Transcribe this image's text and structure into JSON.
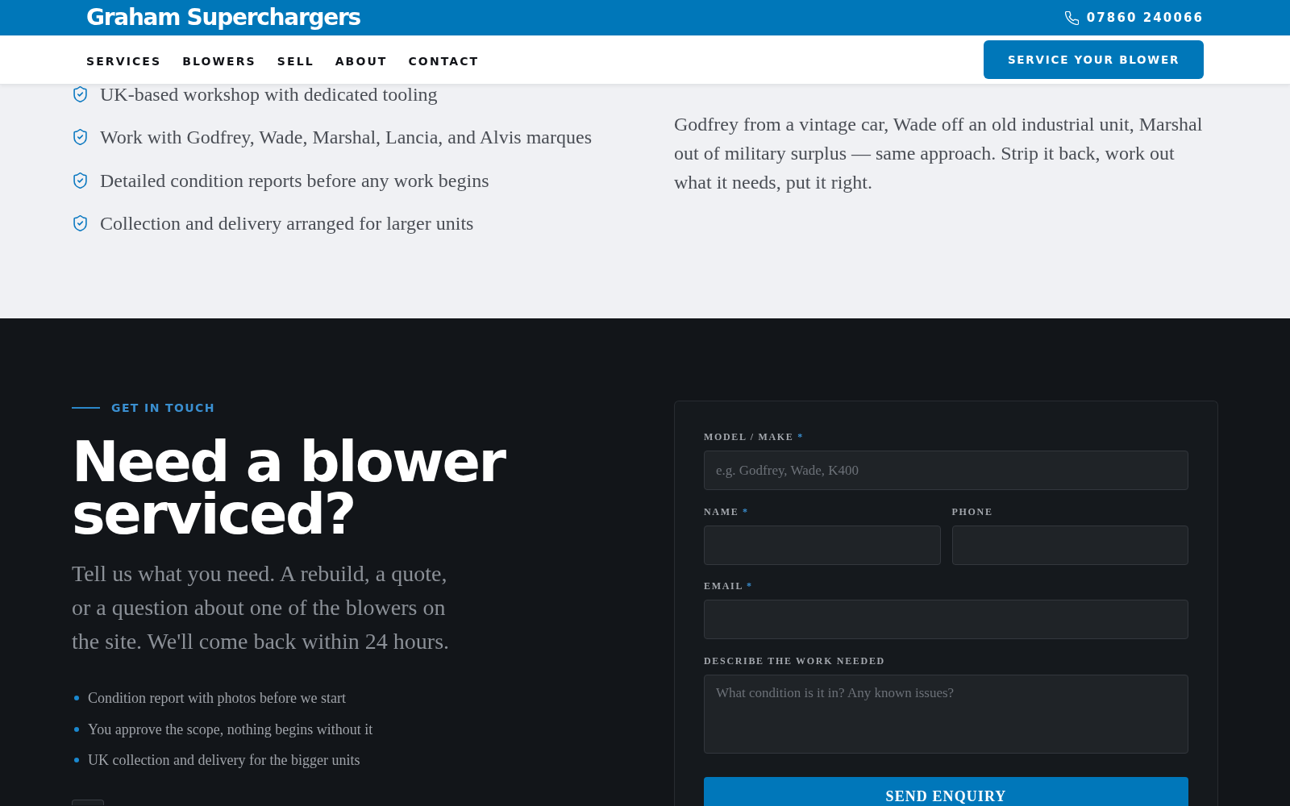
{
  "top_bar": {
    "logo": "Graham Superchargers",
    "phone": "07860 240066"
  },
  "nav": {
    "items": [
      {
        "label": "SERVICES"
      },
      {
        "label": "BLOWERS"
      },
      {
        "label": "SELL"
      },
      {
        "label": "ABOUT"
      },
      {
        "label": "CONTACT"
      }
    ],
    "cta": "SERVICE YOUR BLOWER"
  },
  "features": {
    "items": [
      "UK-based workshop with dedicated tooling",
      "Work with Godfrey, Wade, Marshal, Lancia, and Alvis marques",
      "Detailed condition reports before any work begins",
      "Collection and delivery arranged for larger units"
    ],
    "paragraph": "Godfrey from a vintage car, Wade off an old industrial unit, Marshal out of military surplus — same approach. Strip it back, work out what it needs, put it right."
  },
  "contact": {
    "eyebrow": "GET IN TOUCH",
    "heading": "Need a blower serviced?",
    "intro": "Tell us what you need. A rebuild, a quote, or a question about one of the blowers on the site. We'll come back within 24 hours.",
    "points": [
      "Condition report with photos before we start",
      "You approve the scope, nothing begins without it",
      "UK collection and delivery for the bigger units"
    ],
    "form": {
      "rows": [
        {
          "fields": [
            {
              "kind": "input",
              "label": "MODEL / MAKE",
              "required_mark": "*",
              "placeholder": "e.g. Godfrey, Wade, K400"
            }
          ]
        },
        {
          "fields": [
            {
              "kind": "input",
              "label": "NAME",
              "required_mark": "*"
            },
            {
              "kind": "input",
              "label": "PHONE"
            }
          ]
        },
        {
          "fields": [
            {
              "kind": "input",
              "label": "EMAIL",
              "required_mark": "*"
            }
          ]
        },
        {
          "fields": [
            {
              "kind": "textarea",
              "label": "DESCRIBE THE WORK NEEDED",
              "placeholder": "What condition is it in? Any known issues?"
            }
          ]
        }
      ],
      "submit": "SEND ENQUIRY"
    }
  }
}
